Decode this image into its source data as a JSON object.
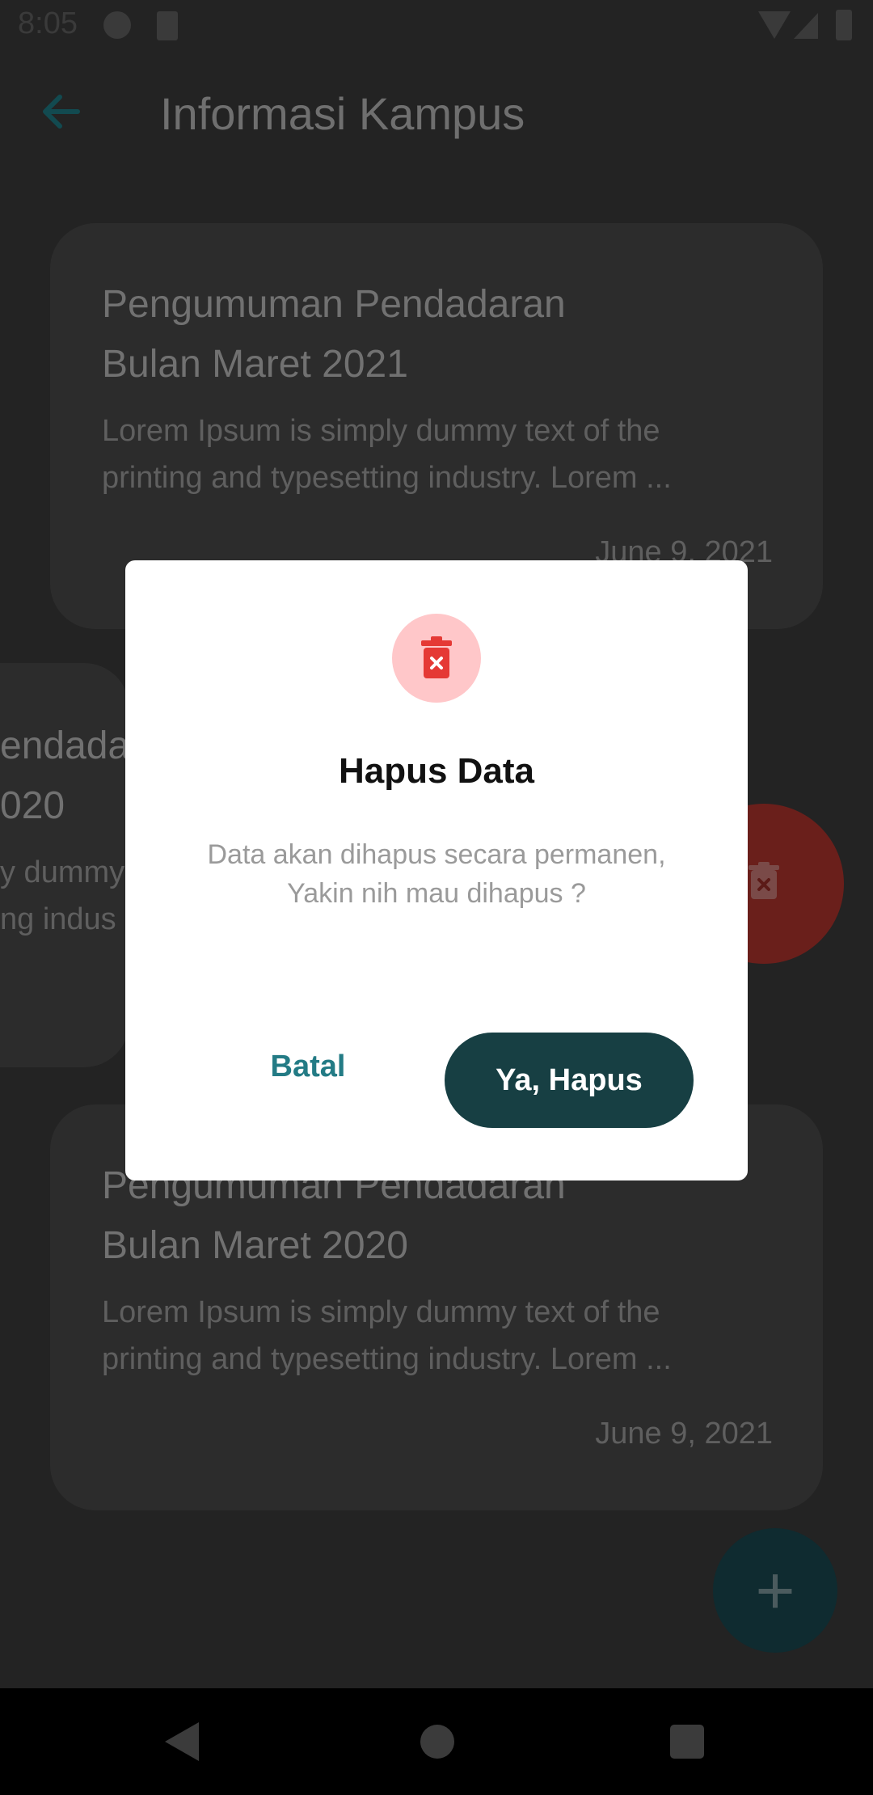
{
  "status_bar": {
    "time": "8:05"
  },
  "app_bar": {
    "title": "Informasi Kampus"
  },
  "cards": [
    {
      "title_line1": "Pengumuman Pendadaran",
      "title_line2": "Bulan Maret 2021",
      "body_line1": "Lorem Ipsum is simply dummy text of the",
      "body_line2": "printing and typesetting industry. Lorem ...",
      "date": "June 9, 2021"
    },
    {
      "title_line1": "endada",
      "title_line2": "020",
      "body_line1": "y dummy",
      "body_line2": "ng indus"
    },
    {
      "title_line1": "Pengumuman Pendadaran",
      "title_line2": "Bulan Maret 2020",
      "body_line1": "Lorem Ipsum is simply dummy text of the",
      "body_line2": "printing and typesetting industry. Lorem ...",
      "date": "June 9, 2021"
    }
  ],
  "fab": {
    "icon": "plus-icon",
    "label": "+"
  },
  "dialog": {
    "icon": "trash-x-icon",
    "title": "Hapus Data",
    "message_line1": "Data akan dihapus secara permanen,",
    "message_line2": "Yakin nih mau dihapus ?",
    "cancel_label": "Batal",
    "confirm_label": "Ya, Hapus"
  },
  "colors": {
    "accent_teal": "#237b85",
    "confirm_bg": "#173f43",
    "danger_red": "#e53935",
    "icon_bg": "#ffc7c9"
  }
}
